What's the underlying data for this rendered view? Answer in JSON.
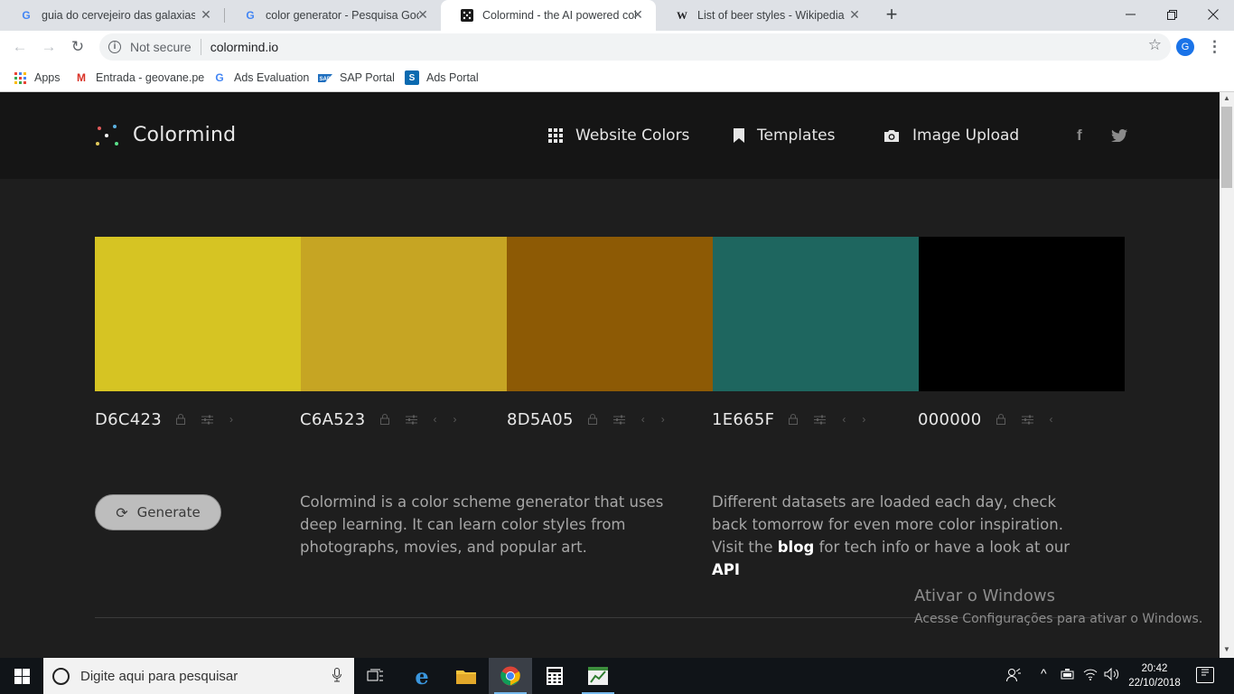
{
  "browser": {
    "tabs": [
      {
        "title": "guia do cervejeiro das galaxias - ",
        "favicon": "google-g-icon",
        "active": false
      },
      {
        "title": "color generator - Pesquisa Goog",
        "favicon": "google-g-icon",
        "active": false
      },
      {
        "title": "Colormind - the AI powered colo",
        "favicon": "colormind-favicon",
        "active": true
      },
      {
        "title": "List of beer styles - Wikipedia",
        "favicon": "wikipedia-w-icon",
        "active": false
      }
    ],
    "security_label": "Not secure",
    "url": "colormind.io",
    "profile_initial": "G",
    "bookmarks": [
      {
        "label": "Apps",
        "icon": "apps-grid-icon"
      },
      {
        "label": "Entrada - geovane.pe",
        "icon": "gmail-icon"
      },
      {
        "label": "Ads Evaluation",
        "icon": "google-g-icon"
      },
      {
        "label": "SAP Portal",
        "icon": "sap-icon"
      },
      {
        "label": "Ads Portal",
        "icon": "sharepoint-icon"
      }
    ]
  },
  "site": {
    "brand": "Colormind",
    "nav": [
      {
        "label": "Website Colors",
        "icon": "grid-icon"
      },
      {
        "label": "Templates",
        "icon": "bookmark-icon"
      },
      {
        "label": "Image Upload",
        "icon": "camera-icon"
      }
    ],
    "social": [
      "facebook-icon",
      "twitter-icon"
    ]
  },
  "palette": [
    {
      "hex": "D6C423",
      "color": "#d6c423"
    },
    {
      "hex": "C6A523",
      "color": "#c6a523"
    },
    {
      "hex": "8D5A05",
      "color": "#8d5a05"
    },
    {
      "hex": "1E665F",
      "color": "#1e665f"
    },
    {
      "hex": "000000",
      "color": "#000000"
    }
  ],
  "generate_label": "Generate",
  "description_left": "Colormind is a color scheme generator that uses deep learning. It can learn color styles from photographs, movies, and popular art.",
  "description_right": {
    "before": "Different datasets are loaded each day, check back tomorrow for even more color inspiration. Visit the ",
    "link1": "blog",
    "middle": " for tech info or have a look at our ",
    "link2": "API"
  },
  "watermark": {
    "title": "Ativar o Windows",
    "subtitle": "Acesse Configurações para ativar o Windows."
  },
  "taskbar": {
    "search_placeholder": "Digite aqui para pesquisar",
    "time": "20:42",
    "date": "22/10/2018"
  }
}
